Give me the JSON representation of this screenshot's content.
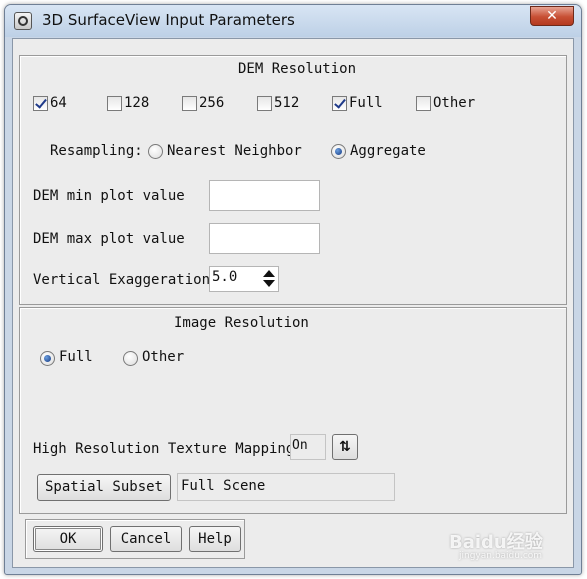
{
  "window": {
    "title": "3D SurfaceView Input Parameters",
    "close_glyph": "✕",
    "app_icon": "app-window-icon"
  },
  "dem": {
    "section_title": "DEM Resolution",
    "resolutions": [
      {
        "label": "64",
        "checked": true
      },
      {
        "label": "128",
        "checked": false
      },
      {
        "label": "256",
        "checked": false
      },
      {
        "label": "512",
        "checked": false
      },
      {
        "label": "Full",
        "checked": true
      },
      {
        "label": "Other",
        "checked": false
      }
    ],
    "resampling_label": "Resampling:",
    "resampling_options": [
      {
        "label": "Nearest Neighbor",
        "selected": false
      },
      {
        "label": "Aggregate",
        "selected": true
      }
    ],
    "min_label": "DEM min plot value",
    "min_value": "",
    "max_label": "DEM max plot value",
    "max_value": "",
    "exaggeration_label": "Vertical Exaggeration",
    "exaggeration_value": "5.0"
  },
  "image": {
    "section_title": "Image Resolution",
    "options": [
      {
        "label": "Full",
        "selected": true
      },
      {
        "label": "Other",
        "selected": false
      }
    ],
    "texture_label": "High Resolution Texture Mapping",
    "texture_value": "On",
    "spatial_subset_button": "Spatial Subset",
    "spatial_subset_value": "Full Scene"
  },
  "buttons": {
    "ok": "OK",
    "cancel": "Cancel",
    "help": "Help"
  },
  "watermark": {
    "text": "Baidu经验",
    "sub": "jingyan.baidu.com"
  }
}
